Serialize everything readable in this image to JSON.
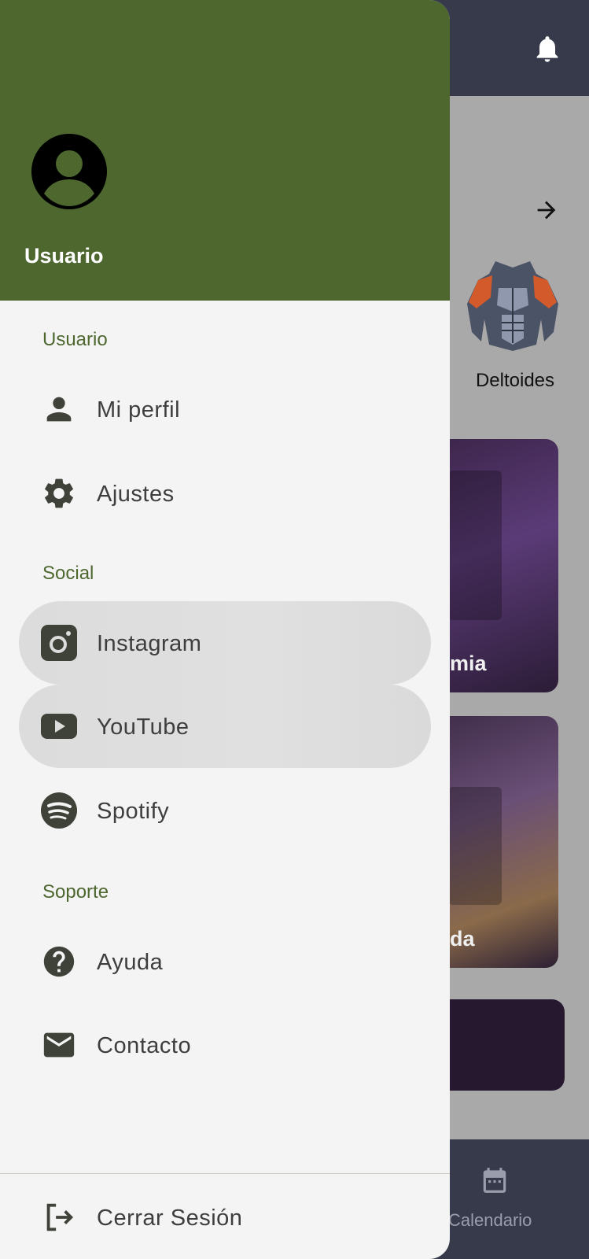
{
  "background": {
    "muscle_label": "Deltoides",
    "card1_label": "mia",
    "card2_label": "da",
    "bottom_nav_label": "Calendario"
  },
  "drawer": {
    "username": "Usuario",
    "sections": {
      "user": "Usuario",
      "social": "Social",
      "support": "Soporte"
    },
    "items": {
      "profile": "Mi perfil",
      "settings": "Ajustes",
      "instagram": "Instagram",
      "youtube": "YouTube",
      "spotify": "Spotify",
      "help": "Ayuda",
      "contact": "Contacto",
      "logout": "Cerrar Sesión"
    },
    "icons": {
      "profile": "person-icon",
      "settings": "gear-icon",
      "instagram": "instagram-icon",
      "youtube": "youtube-icon",
      "spotify": "spotify-icon",
      "help": "help-icon",
      "contact": "mail-icon",
      "logout": "logout-icon"
    }
  },
  "colors": {
    "header_green": "#4d672f",
    "section_green": "#4d672f",
    "drawer_bg": "#f4f4f4",
    "highlight_bg": "#dcdcdc",
    "topbar_bg": "#363a4b",
    "icon_dark": "#3f4239"
  }
}
